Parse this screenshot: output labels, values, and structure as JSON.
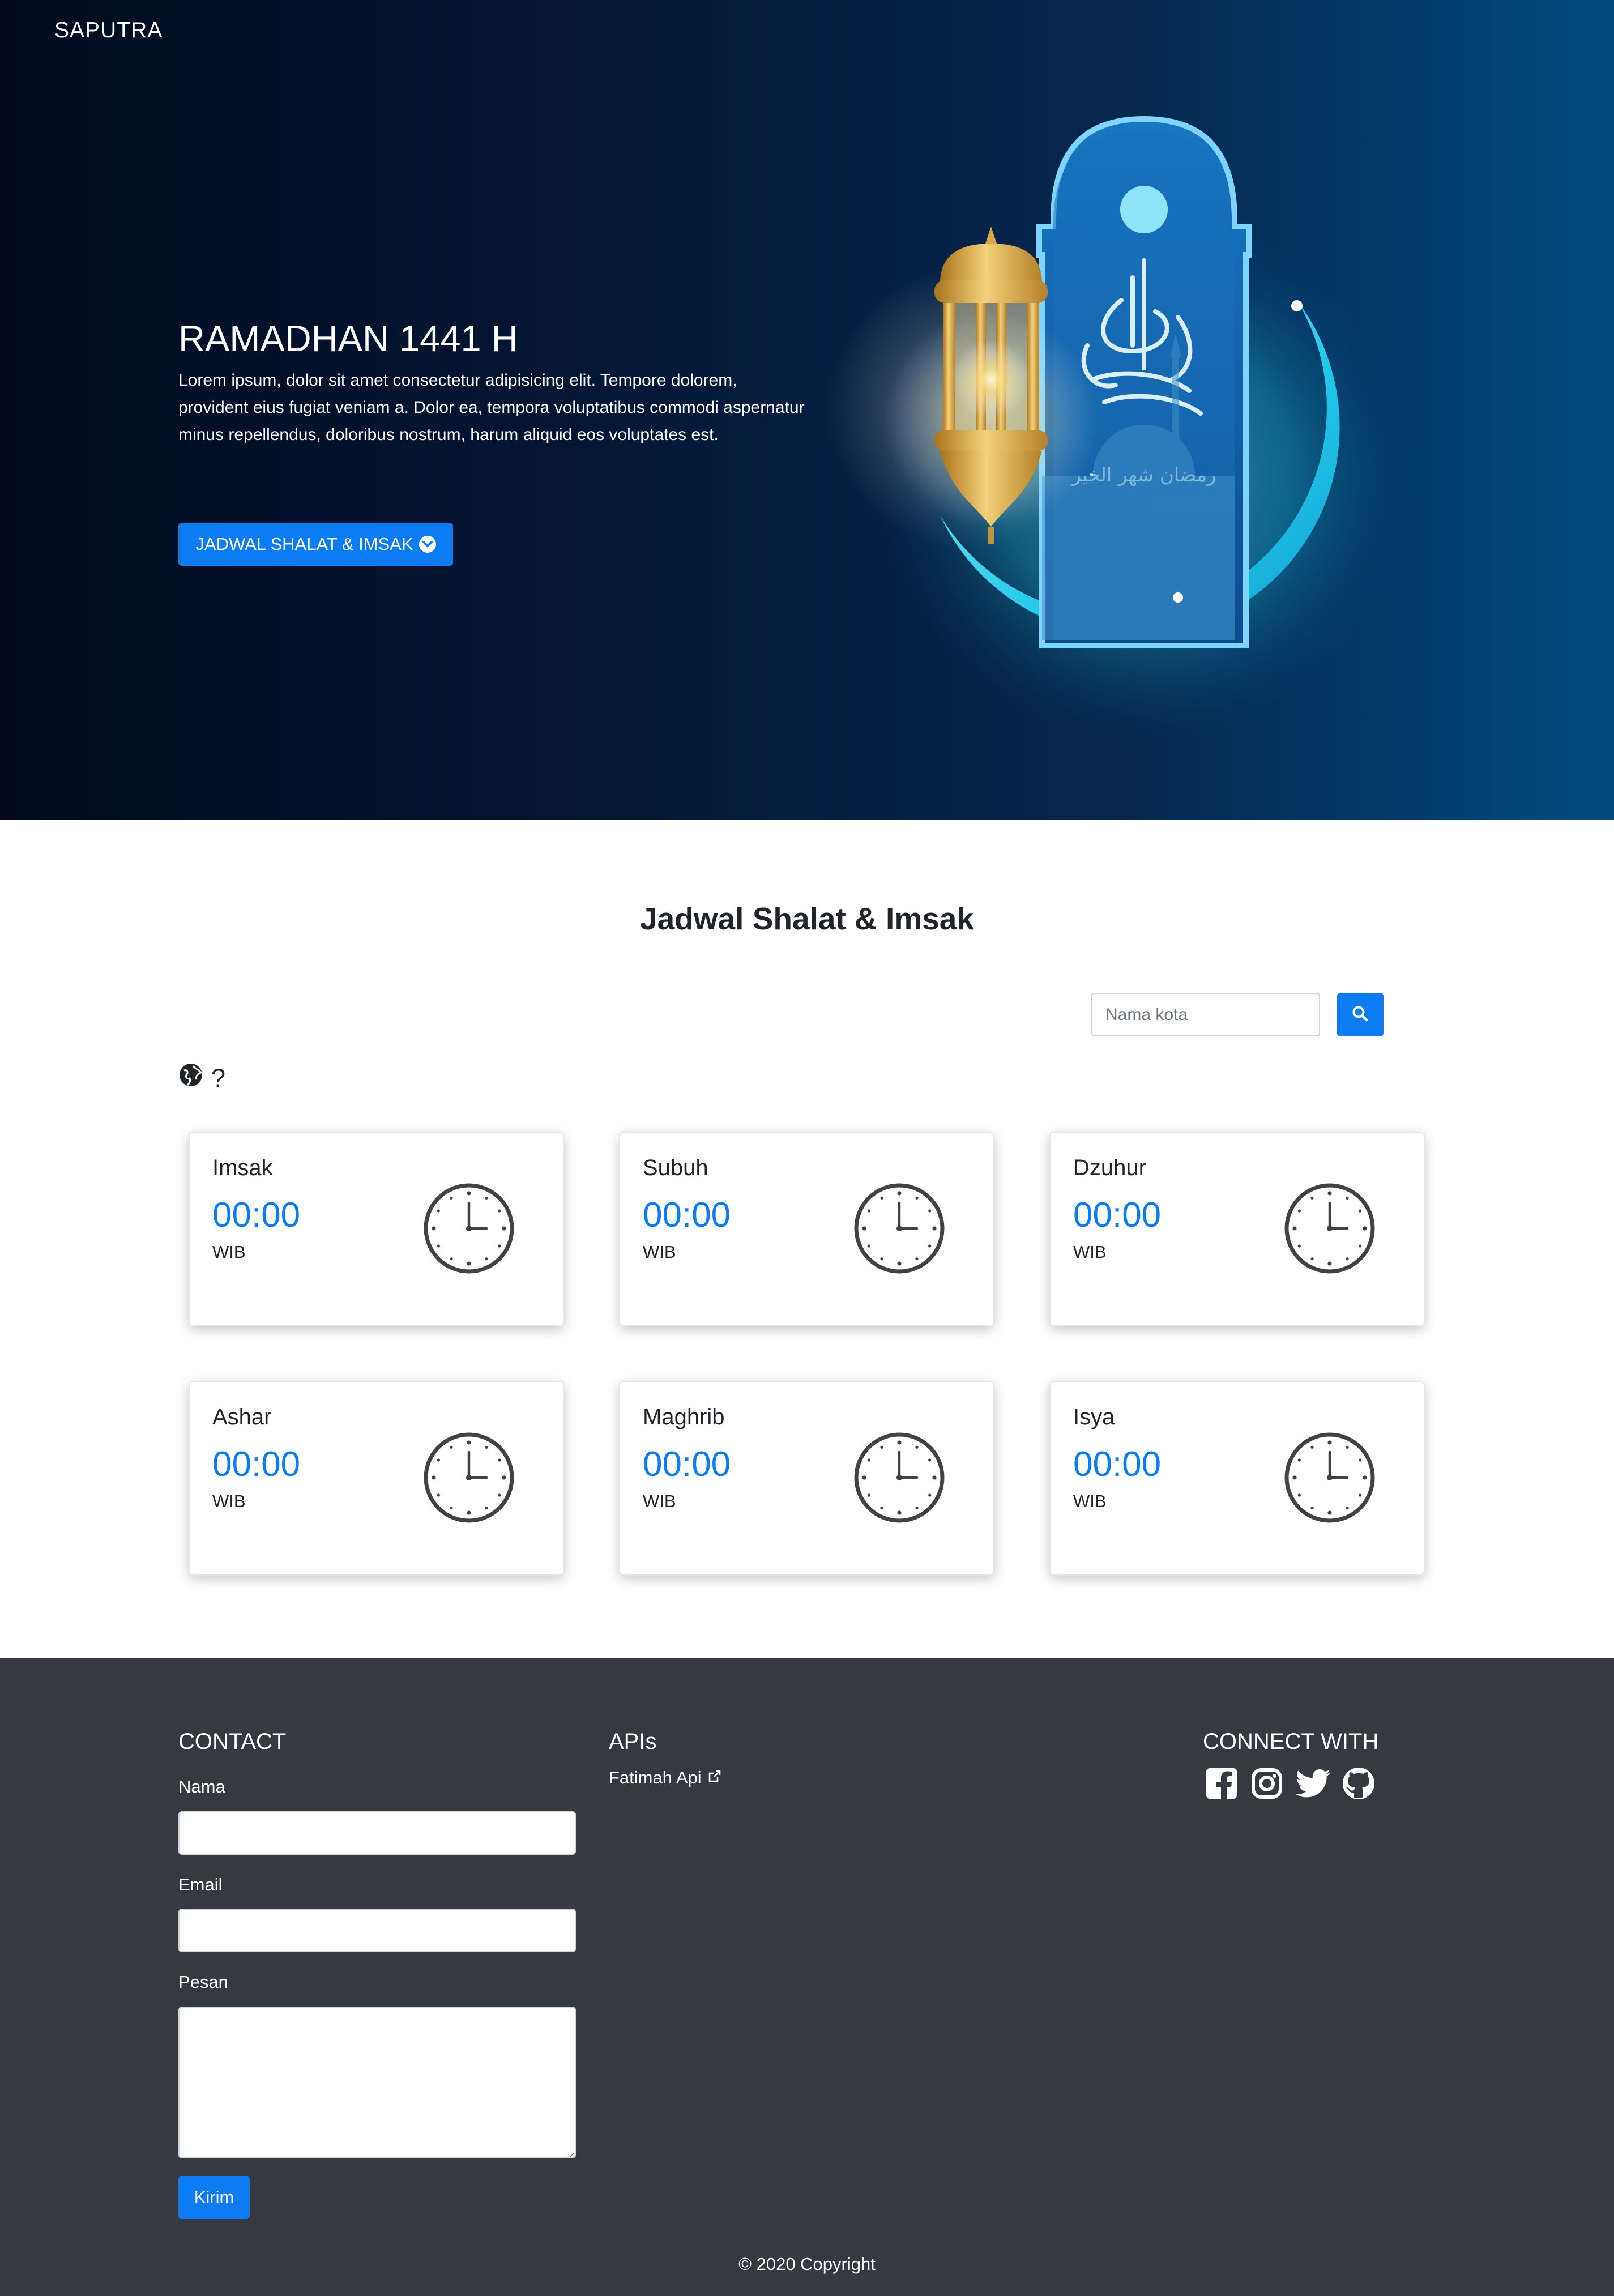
{
  "brand": "SAPUTRA",
  "hero": {
    "title": "RAMADHAN 1441 H",
    "text": "Lorem ipsum, dolor sit amet consectetur adipisicing elit. Tempore dolorem, provident eius fugiat veniam a. Dolor ea, tempora voluptatibus commodi aspernatur minus repellendus, doloribus nostrum, harum aliquid eos voluptates est.",
    "button_label": "JADWAL SHALAT & IMSAK",
    "button_icon": "chevron-circle-down-icon",
    "illustration_icons": [
      "lantern-icon",
      "crescent-moon-icon",
      "mosque-icon"
    ]
  },
  "schedule": {
    "title": "Jadwal Shalat & Imsak",
    "search": {
      "placeholder": "Nama kota",
      "value": "",
      "button_icon": "search-icon"
    },
    "location": {
      "icon": "globe-icon",
      "text": "?"
    },
    "cards": [
      {
        "name": "Imsak",
        "time": "00:00",
        "tz": "WIB",
        "icon": "clock-icon"
      },
      {
        "name": "Subuh",
        "time": "00:00",
        "tz": "WIB",
        "icon": "clock-icon"
      },
      {
        "name": "Dzuhur",
        "time": "00:00",
        "tz": "WIB",
        "icon": "clock-icon"
      },
      {
        "name": "Ashar",
        "time": "00:00",
        "tz": "WIB",
        "icon": "clock-icon"
      },
      {
        "name": "Maghrib",
        "time": "00:00",
        "tz": "WIB",
        "icon": "clock-icon"
      },
      {
        "name": "Isya",
        "time": "00:00",
        "tz": "WIB",
        "icon": "clock-icon"
      }
    ]
  },
  "footer": {
    "contact": {
      "title": "CONTACT",
      "name_label": "Nama",
      "email_label": "Email",
      "message_label": "Pesan",
      "name_value": "",
      "email_value": "",
      "message_value": "",
      "submit_label": "Kirim"
    },
    "apis": {
      "title": "APIs",
      "link_label": "Fatimah Api",
      "link_icon": "external-link-icon"
    },
    "connect": {
      "title": "CONNECT WITH",
      "icons": [
        "facebook-icon",
        "instagram-icon",
        "twitter-icon",
        "github-icon"
      ]
    },
    "copyright": "© 2020 Copyright"
  },
  "colors": {
    "primary": "#0d7bf2",
    "hero_dark": "#020b1e",
    "hero_light": "#004a80",
    "footer_bg": "#343a40",
    "moon_glow": "#2de3f5"
  }
}
